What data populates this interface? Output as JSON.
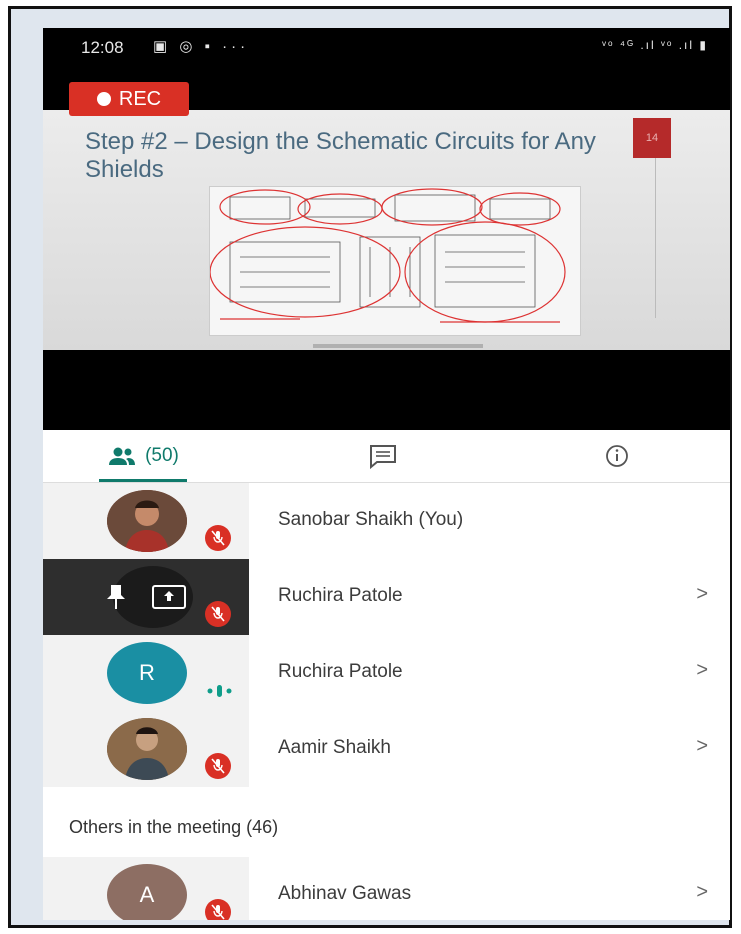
{
  "status_bar": {
    "time": "12:08",
    "left_icons": "▣ ◎ ▪ ···",
    "right_icons": "ᵛᵒ ⁴ᴳ .ıl ᵛᵒ .ıl ▮"
  },
  "recording": {
    "label": "REC"
  },
  "slide": {
    "title": "Step #2 – Design the Schematic Circuits for Any Shields",
    "page_number": "14"
  },
  "tabs": {
    "people_count": "(50)",
    "people_icon": "people-icon",
    "chat_icon": "chat-icon",
    "info_icon": "info-icon"
  },
  "participants": [
    {
      "name": "Sanobar Shaikh (You)",
      "avatar": "photo",
      "muted": true
    },
    {
      "name": "Ruchira Patole",
      "avatar": "screen-share",
      "muted": true
    },
    {
      "name": "Ruchira Patole",
      "avatar_letter": "R",
      "speaking": true
    },
    {
      "name": "Aamir Shaikh",
      "avatar": "photo",
      "muted": true
    }
  ],
  "others": {
    "label": "Others in the meeting (46)",
    "items": [
      {
        "name": "Abhinav Gawas",
        "avatar_letter": "A",
        "muted": true
      }
    ]
  },
  "colors": {
    "accent": "#0f7a6b",
    "rec_red": "#d93025",
    "avatar_teal": "#1a8fa3",
    "avatar_brown": "#8d6e63"
  }
}
